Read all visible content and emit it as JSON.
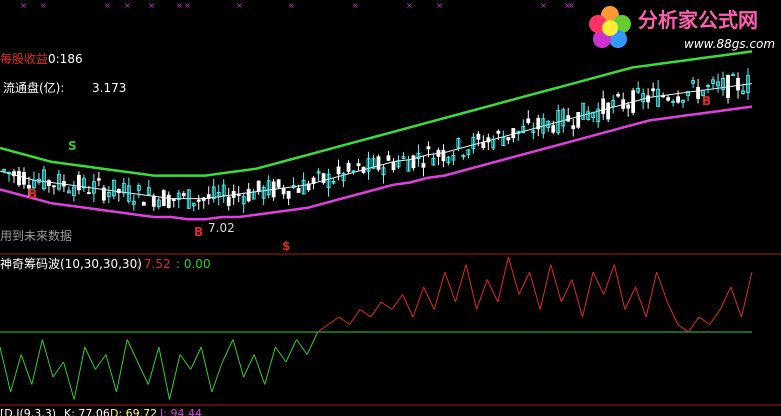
{
  "top_panel": {
    "eps_label": "每股收益",
    "eps_value": "0:186",
    "float_label": "流通盘(亿):",
    "float_value": "3.173",
    "future_note": "用到未来数据",
    "low_price": "7.02",
    "markers": [
      "B",
      "S",
      "B",
      "B",
      "$"
    ]
  },
  "bottom_panel": {
    "indicator_name": "神奇筹码波(10,30,30,30)",
    "value_red": ": 7.52",
    "value_green": ": 0.00"
  },
  "footer": {
    "kdj_label": "[D.J(9,3,3)",
    "k_value": "K: 77.06",
    "d_value": "D: 69.72",
    "j_value": "J: 94.44"
  },
  "logo": {
    "title": "分析家公式网",
    "url": "www.88gs.com"
  },
  "colors": {
    "up": "#54ffff",
    "down": "#ffffff",
    "upper_band": "#3cdc3c",
    "lower_band": "#e040e0",
    "mid_line": "#f0f0f0",
    "osc_positive": "#e02a2a",
    "osc_negative": "#33cc33",
    "divider": "#b01818"
  },
  "chart_data": [
    {
      "type": "candlestick",
      "series": [
        {
          "name": "upper",
          "values": [
            40,
            38,
            36,
            34,
            33,
            32,
            31,
            30,
            29,
            28,
            28,
            28,
            28,
            29,
            30,
            31,
            33,
            35,
            37,
            39,
            41,
            43,
            45,
            47,
            49,
            51,
            53,
            55,
            57,
            59,
            61,
            63,
            65,
            67,
            69,
            71,
            73,
            75,
            76,
            77,
            78,
            79,
            80,
            81,
            82
          ]
        },
        {
          "name": "mid",
          "values": [
            30,
            28,
            26,
            25,
            24,
            23,
            22,
            21,
            20,
            19,
            18,
            18,
            18,
            19,
            20,
            21,
            22,
            23,
            24,
            26,
            28,
            30,
            32,
            34,
            35,
            37,
            38,
            40,
            42,
            44,
            46,
            48,
            50,
            52,
            54,
            56,
            58,
            60,
            62,
            63,
            64,
            65,
            66,
            67,
            68
          ]
        },
        {
          "name": "lower",
          "values": [
            22,
            20,
            18,
            16,
            15,
            14,
            13,
            12,
            11,
            10,
            10,
            9,
            9,
            10,
            10,
            11,
            12,
            13,
            14,
            16,
            18,
            20,
            22,
            24,
            25,
            27,
            28,
            30,
            32,
            34,
            36,
            38,
            40,
            42,
            44,
            46,
            48,
            50,
            52,
            53,
            54,
            55,
            56,
            57,
            58
          ]
        }
      ],
      "low_annotation": 7.02
    },
    {
      "type": "line",
      "series": [
        {
          "name": "神奇筹码波",
          "values": [
            -2,
            -8,
            -3,
            -7,
            -1,
            -6,
            -4,
            -9,
            -2,
            -5,
            -3,
            -8,
            -1,
            -4,
            -7,
            -2,
            -9,
            -3,
            -5,
            -2,
            -8,
            -4,
            -1,
            -6,
            -3,
            -7,
            -2,
            -4,
            -1,
            -3,
            0,
            1,
            2,
            1,
            3,
            2,
            4,
            3,
            5,
            2,
            6,
            3,
            8,
            4,
            9,
            3,
            7,
            4,
            10,
            5,
            8,
            3,
            9,
            4,
            7,
            2,
            8,
            5,
            9,
            3,
            6,
            2,
            8,
            4,
            1,
            0,
            2,
            1,
            3,
            6,
            2,
            8
          ]
        }
      ],
      "current_red": 7.52,
      "current_green": 0.0
    }
  ]
}
